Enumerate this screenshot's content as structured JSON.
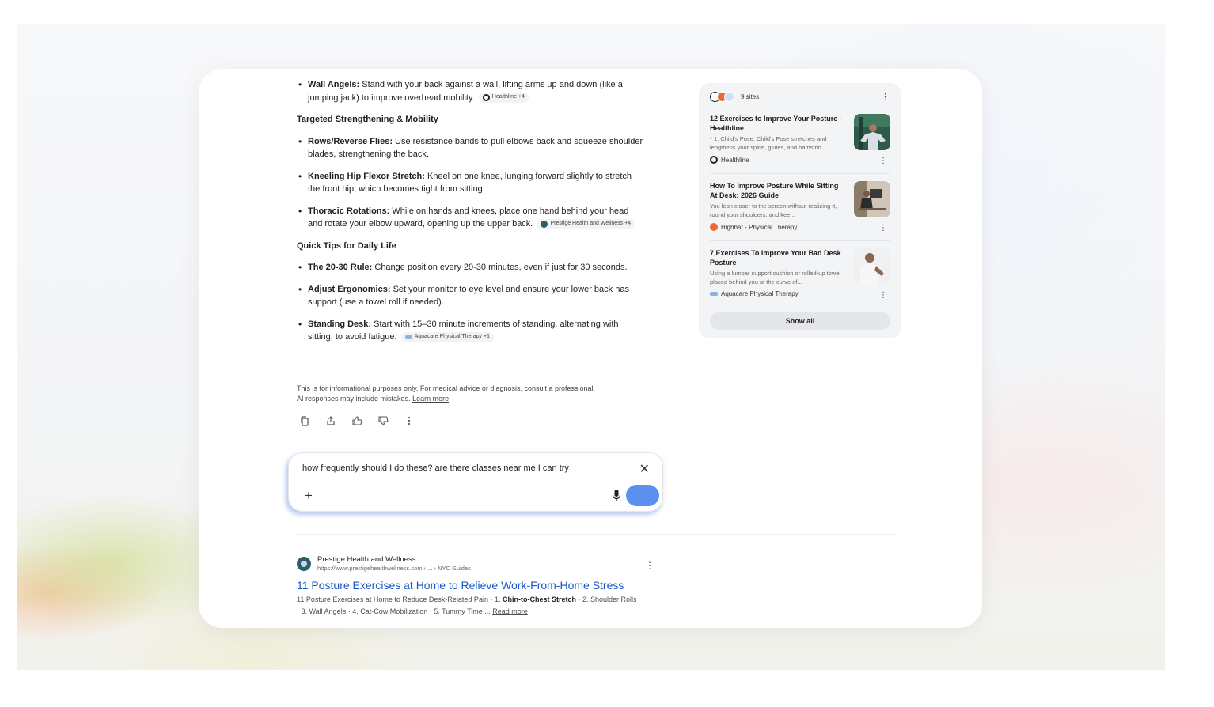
{
  "answer": {
    "wall_angels": {
      "bold": "Wall Angels:",
      "text": " Stand with your back against a wall, lifting arms up and down (like a jumping jack) to improve overhead mobility.",
      "chip": "Healthline +4"
    },
    "heading_strength": "Targeted Strengthening & Mobility",
    "rows": {
      "bold": "Rows/Reverse Flies:",
      "text": " Use resistance bands to pull elbows back and squeeze shoulder blades, strengthening the back."
    },
    "kneeling": {
      "bold": "Kneeling Hip Flexor Stretch:",
      "text": "  Kneel on one knee, lunging forward slightly to stretch the front hip, which becomes tight from sitting."
    },
    "thoracic": {
      "bold": "Thoracic Rotations:",
      "text": " While on hands and knees, place one hand behind your head and rotate your elbow upward, opening up the upper back.",
      "chip": "Prestige Health and Wellness +4"
    },
    "heading_tips": "Quick Tips for Daily Life",
    "rule": {
      "bold": "The 20-30 Rule:",
      "text": " Change position every 20-30 minutes, even if just for 30 seconds."
    },
    "ergonomics": {
      "bold": "Adjust Ergonomics:",
      "text": " Set your monitor to eye level and ensure your lower back has support (use a towel roll if needed)."
    },
    "standing": {
      "bold": "Standing Desk:",
      "text": " Start with 15–30 minute increments of standing, alternating with sitting, to avoid fatigue.",
      "chip": "Aquacare Physical Therapy +1"
    },
    "disclaimer_1": "This is for informational purposes only. For medical advice or diagnosis, consult a professional.",
    "disclaimer_2": "AI responses may include mistakes. ",
    "learn_more": "Learn more"
  },
  "actions": [
    "copy-icon",
    "share-icon",
    "thumbs-up-icon",
    "thumbs-down-icon",
    "more-vert-icon"
  ],
  "input": {
    "value": "how frequently should I do these? are there classes near me I can try",
    "close": "✕",
    "plus": "+"
  },
  "sources_panel": {
    "count_label": "9 sites",
    "items": [
      {
        "title": "12 Exercises to Improve Your Posture - Healthline",
        "desc": "* 1. Child's Pose. Child's Pose stretches and lengthens your spine, glutes, and hamstrin...",
        "source": "Healthline"
      },
      {
        "title": "How To Improve Posture While Sitting At Desk: 2026 Guide",
        "desc": "You lean closer to the screen without realizing it, round your shoulders, and kee...",
        "source": "Highbar - Physical Therapy"
      },
      {
        "title": "7 Exercises To Improve Your Bad Desk Posture",
        "desc": "Using a lumbar support cushion or rolled-up towel placed behind you at the curve of...",
        "source": "Aquacare Physical Therapy"
      }
    ],
    "show_all": "Show all"
  },
  "result": {
    "site": "Prestige Health and Wellness",
    "url": "https://www.prestigehealthwellness.com › ... › NYC Guides",
    "title": "11 Posture Exercises at Home to Relieve Work-From-Home Stress",
    "snippet_a": "11 Posture Exercises at Home to Reduce Desk-Related Pain · 1. ",
    "snippet_bold": "Chin-to-Chest Stretch",
    "snippet_b": " · 2. Shoulder Rolls",
    "snippet_c": "· 3. Wall Angels · 4. Cat-Cow Mobilization · 5. Tummy Time ... ",
    "read_more": "Read more"
  },
  "colors": {
    "link_blue": "#1a57c8",
    "send_blue": "#5b8ff0",
    "panel_bg": "#f3f4f6"
  }
}
